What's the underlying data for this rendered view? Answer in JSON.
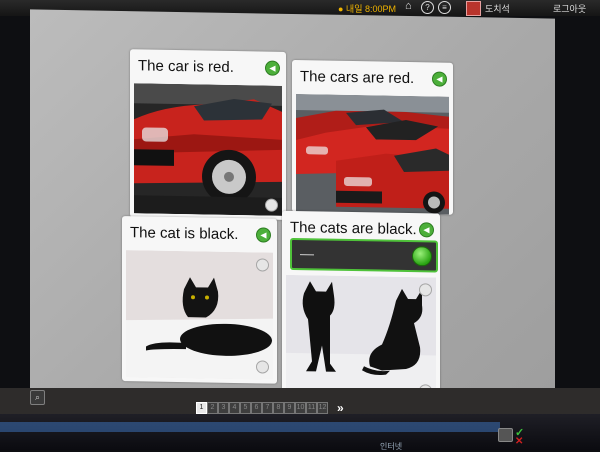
{
  "topbar": {
    "schedule": "● 내일 8:00PM",
    "user": "도치석",
    "logout": "로그아웃",
    "help_glyph": "?",
    "menu_glyph": "≡"
  },
  "cards": [
    {
      "caption": "The car is red."
    },
    {
      "caption": "The cars are red."
    },
    {
      "caption": "The cat is black."
    },
    {
      "caption": "The cats are black."
    }
  ],
  "pager": {
    "pages": [
      "1",
      "2",
      "3",
      "4",
      "5",
      "6",
      "7",
      "8",
      "9",
      "10",
      "11",
      "12"
    ],
    "current": "1",
    "next": "»"
  },
  "taskbar": {
    "tray": "인터넷"
  },
  "colors": {
    "accent_green": "#4fc23a",
    "panel_gray": "#b5b5b5",
    "topbar_orange": "#f0b400"
  },
  "icons": {
    "home": "home-icon",
    "help": "help-icon",
    "menu": "menu-icon",
    "speaker": "speaker-icon",
    "zoom": "magnifier-icon",
    "check": "checkmark-icon",
    "cross": "cross-icon"
  }
}
